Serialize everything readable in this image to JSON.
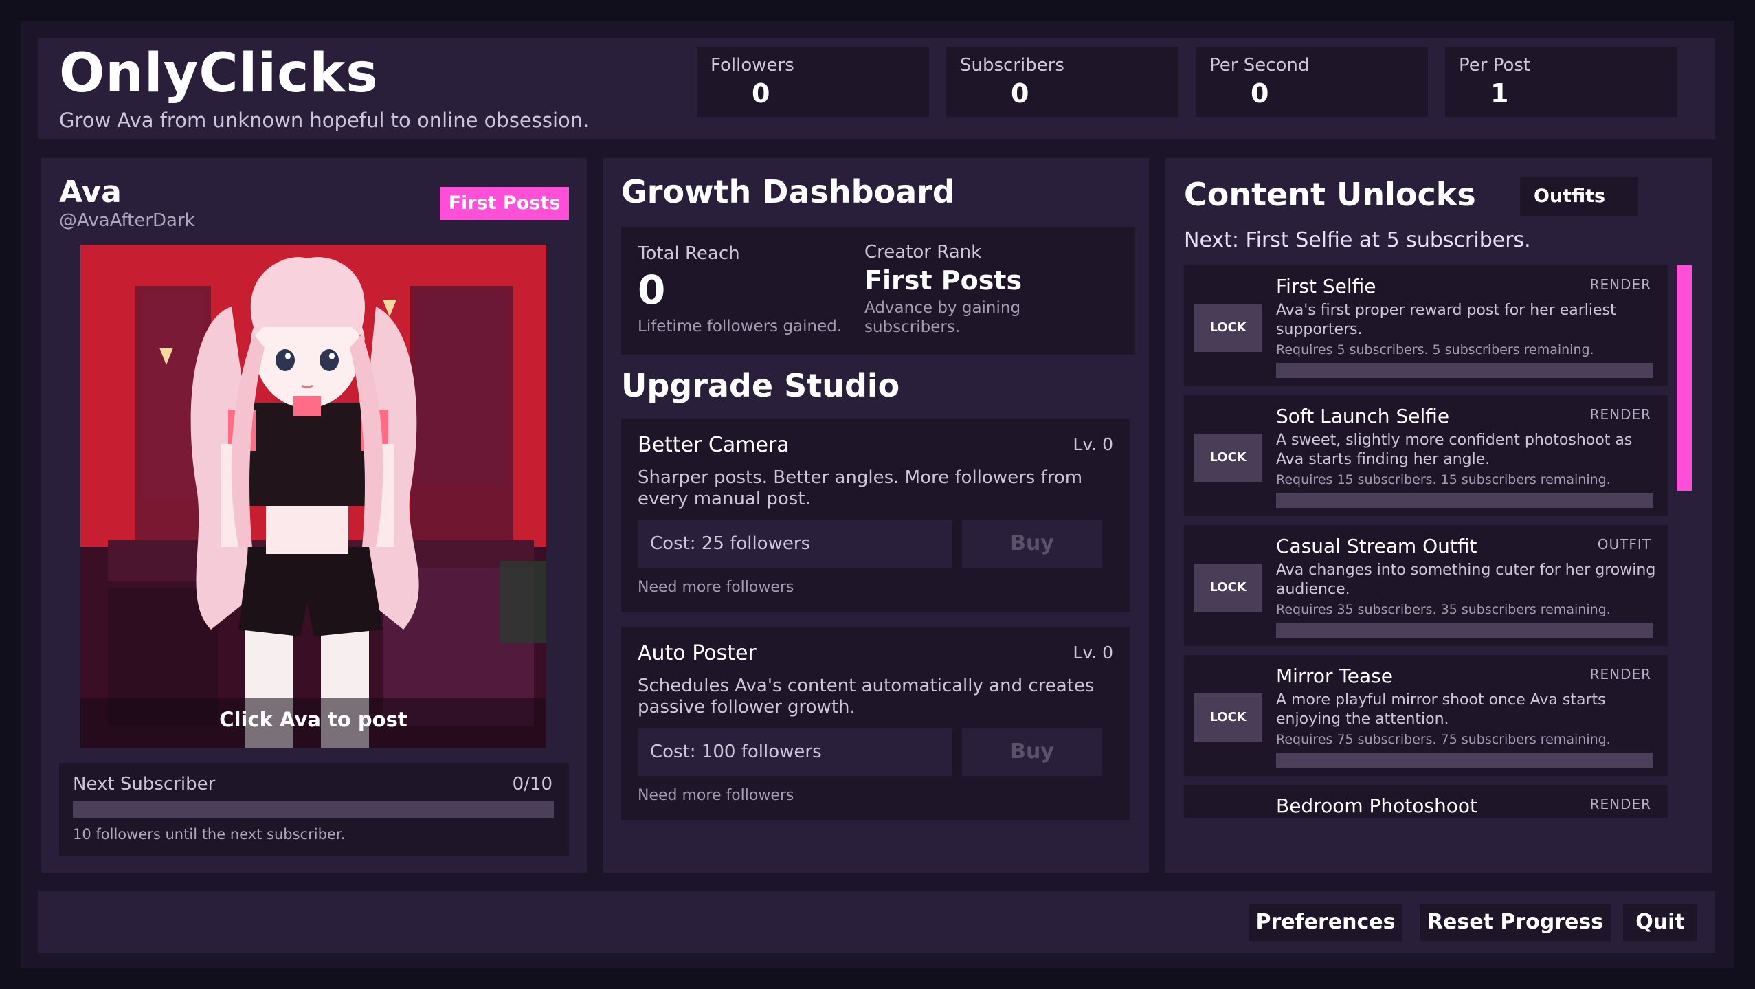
{
  "header": {
    "title": "OnlyClicks",
    "subtitle": "Grow Ava from unknown hopeful to online obsession.",
    "stats": [
      {
        "label": "Followers",
        "value": "0"
      },
      {
        "label": "Subscribers",
        "value": "0"
      },
      {
        "label": "Per Second",
        "value": "0"
      },
      {
        "label": "Per Post",
        "value": "1"
      }
    ]
  },
  "profile": {
    "name": "Ava",
    "handle": "@AvaAfterDark",
    "rank_badge": "First Posts",
    "click_prompt": "Click Ava to post",
    "next_sub_label": "Next Subscriber",
    "next_sub_count": "0/10",
    "next_sub_progress": 0,
    "next_sub_note": "10 followers until the next subscriber."
  },
  "dashboard": {
    "title": "Growth Dashboard",
    "reach_label": "Total Reach",
    "reach_value": "0",
    "reach_note": "Lifetime followers gained.",
    "rank_label": "Creator Rank",
    "rank_value": "First Posts",
    "rank_note": "Advance by gaining subscribers."
  },
  "studio": {
    "title": "Upgrade Studio",
    "upgrades": [
      {
        "name": "Better Camera",
        "level": "Lv. 0",
        "desc": "Sharper posts. Better angles. More followers from every manual post.",
        "cost": "Cost: 25 followers",
        "buy": "Buy",
        "note": "Need more followers"
      },
      {
        "name": "Auto Poster",
        "level": "Lv. 0",
        "desc": "Schedules Ava's content automatically and creates passive follower growth.",
        "cost": "Cost: 100 followers",
        "buy": "Buy",
        "note": "Need more followers"
      }
    ]
  },
  "unlocks": {
    "title": "Content Unlocks",
    "tab": "Outfits",
    "next": "Next: First Selfie at 5 subscribers.",
    "lock_label": "LOCK",
    "items": [
      {
        "name": "First Selfie",
        "type": "RENDER",
        "desc": "Ava's first proper reward post for her earliest supporters.",
        "req": "Requires 5 subscribers. 5 subscribers remaining.",
        "progress": 0
      },
      {
        "name": "Soft Launch Selfie",
        "type": "RENDER",
        "desc": "A sweet, slightly more confident photoshoot as Ava starts finding her angle.",
        "req": "Requires 15 subscribers. 15 subscribers remaining.",
        "progress": 0
      },
      {
        "name": "Casual Stream Outfit",
        "type": "OUTFIT",
        "desc": "Ava changes into something cuter for her growing audience.",
        "req": "Requires 35 subscribers. 35 subscribers remaining.",
        "progress": 0
      },
      {
        "name": "Mirror Tease",
        "type": "RENDER",
        "desc": "A more playful mirror shoot once Ava starts enjoying the attention.",
        "req": "Requires 75 subscribers. 75 subscribers remaining.",
        "progress": 0
      },
      {
        "name": "Bedroom Photoshoot",
        "type": "RENDER"
      }
    ]
  },
  "footer": {
    "preferences": "Preferences",
    "reset": "Reset Progress",
    "quit": "Quit"
  },
  "colors": {
    "accent": "#ff4fd8",
    "background": "#120f1d",
    "panel": "#2a1f3a",
    "card": "#1e1628"
  }
}
